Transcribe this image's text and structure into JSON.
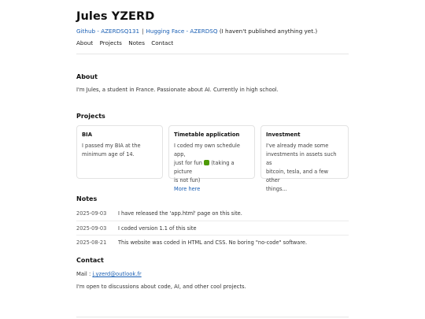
{
  "header": {
    "title": "Jules YZERD",
    "github_link": "Github - AZERDSQ131",
    "separator": "|",
    "hf_link": "Hugging Face - AZERDSQ",
    "hf_note": "(I haven't published anything yet.)"
  },
  "nav": {
    "items": [
      "About",
      "Projects",
      "Notes",
      "Contact"
    ]
  },
  "about": {
    "heading": "About",
    "text": "I'm Jules, a student in France. Passionate about AI. Currently in high school."
  },
  "projects": {
    "heading": "Projects",
    "cards": [
      {
        "title": "BIA",
        "lines": [
          "I passed my BIA at the",
          "minimum age of 14."
        ],
        "link": ""
      },
      {
        "title": "Timetable application",
        "lines": [
          "I coded my own schedule app,",
          "just for fun",
          "(taking a picture",
          "is not fun)"
        ],
        "link": "More here"
      },
      {
        "title": "Investment",
        "lines": [
          "I've already made some",
          "investments in assets such as",
          "bitcoin, tesla, and a few other",
          "things..."
        ],
        "link": ""
      }
    ]
  },
  "notes": {
    "heading": "Notes",
    "items": [
      {
        "date": "2025-09-03",
        "text": "I have released the 'app.html' page on this site."
      },
      {
        "date": "2025-09-03",
        "text": "I coded version 1.1 of this site"
      },
      {
        "date": "2025-08-21",
        "text": "This website was coded in HTML and CSS. No boring \"no-code\" software."
      }
    ]
  },
  "contact": {
    "heading": "Contact",
    "mail_label": "Mail :",
    "mail": "j.yzerd@outlook.fr",
    "text": "I'm open to discussions about code, AI, and other cool projects."
  },
  "colors": {
    "link": "#1a5fb4",
    "text": "#1f1f1f",
    "border": "#e3e3e3"
  }
}
